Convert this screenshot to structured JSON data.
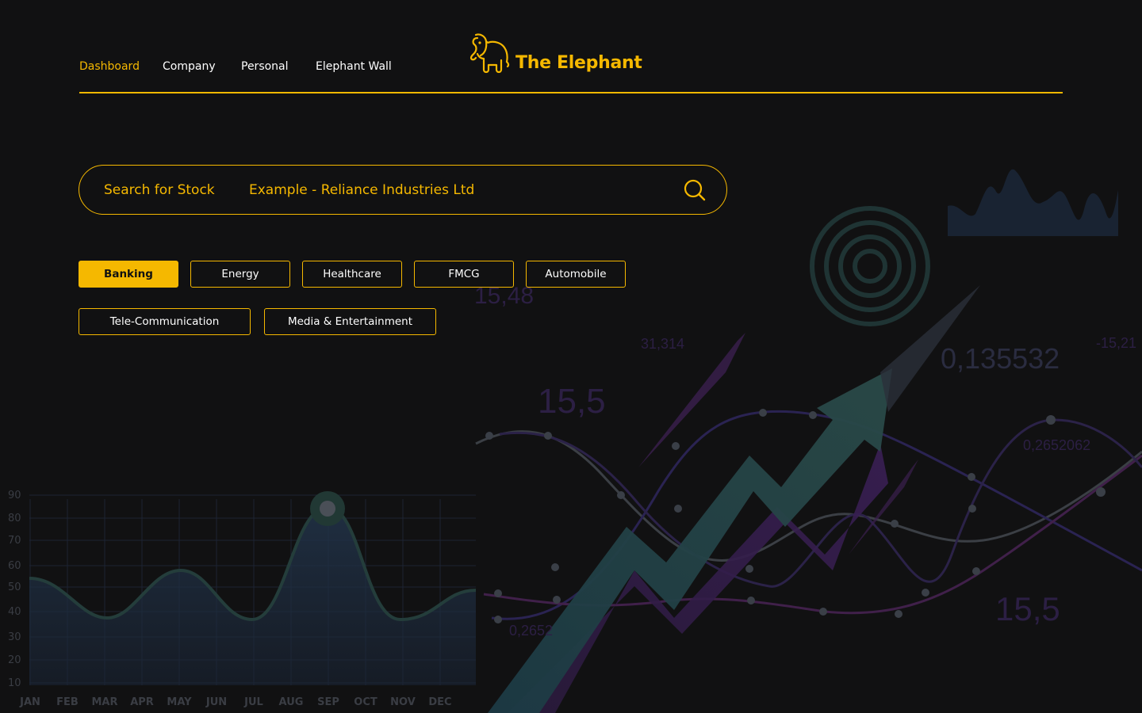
{
  "nav": {
    "items": [
      {
        "label": "Dashboard",
        "active": true
      },
      {
        "label": "Company",
        "active": false
      },
      {
        "label": "Personal",
        "active": false
      },
      {
        "label": "Elephant Wall",
        "active": false
      }
    ]
  },
  "brand": {
    "name": "The Elephant",
    "icon": "elephant-icon"
  },
  "search": {
    "label": "Search for Stock",
    "placeholder": "Example - Reliance Industries Ltd",
    "icon": "search-icon"
  },
  "sectors": [
    {
      "label": "Banking",
      "active": true
    },
    {
      "label": "Energy",
      "active": false
    },
    {
      "label": "Healthcare",
      "active": false
    },
    {
      "label": "FMCG",
      "active": false
    },
    {
      "label": "Automobile",
      "active": false
    },
    {
      "label": "Tele-Communication",
      "active": false
    },
    {
      "label": "Media & Entertainment",
      "active": false
    }
  ],
  "background": {
    "floating_numbers": [
      "15,48",
      "31,314",
      "15,5",
      "0,135532",
      "-15,21",
      "0,2652062",
      "15,5",
      "0,2652"
    ],
    "chart": {
      "y_ticks": [
        "90",
        "80",
        "70",
        "60",
        "50",
        "40",
        "30",
        "20",
        "10"
      ],
      "months": [
        "JAN",
        "FEB",
        "MAR",
        "APR",
        "MAY",
        "JUN",
        "JUL",
        "AUG",
        "SEP",
        "OCT",
        "NOV",
        "DEC"
      ]
    }
  },
  "colors": {
    "accent": "#f5b800",
    "background": "#111112",
    "text": "#ffffff"
  }
}
